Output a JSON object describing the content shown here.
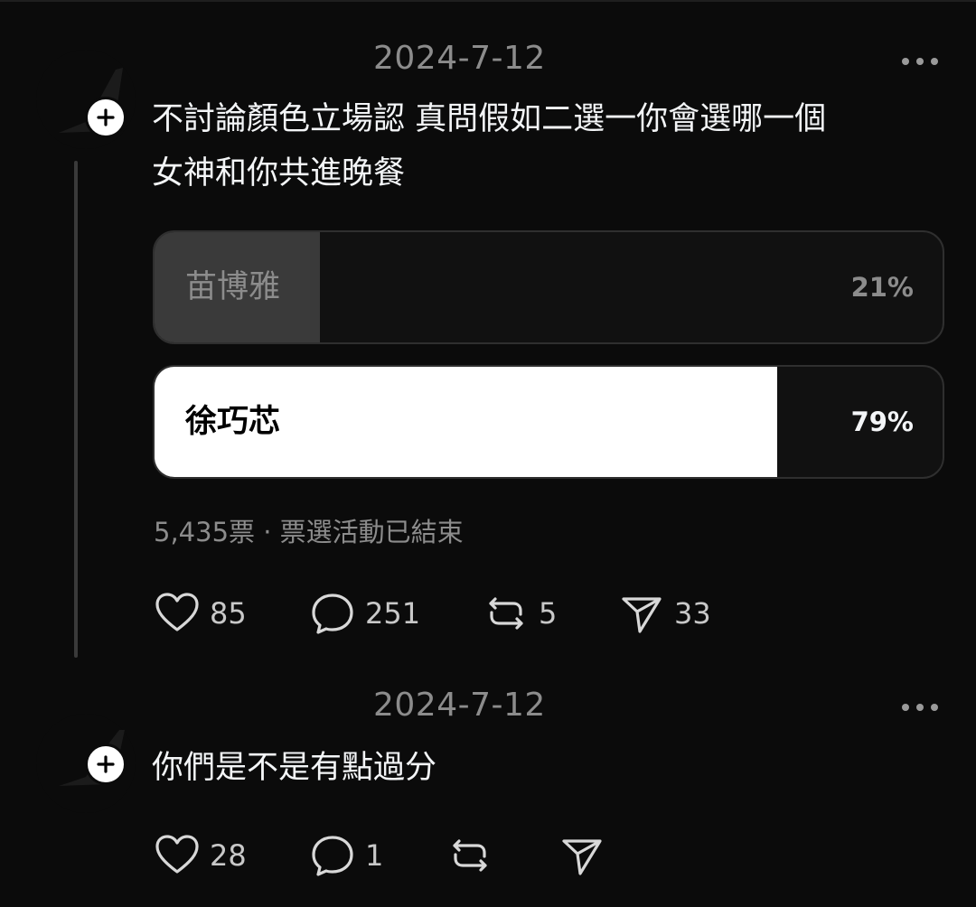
{
  "posts": [
    {
      "date": "2024-7-12",
      "text_line1": "不討論顏色立場認 真問假如二選一你會選哪一個",
      "text_line2": "女神和你共進晚餐",
      "poll": {
        "options": [
          {
            "label": "苗博雅",
            "percent_text": "21%",
            "percent": 21,
            "winner": false
          },
          {
            "label": "徐巧芯",
            "percent_text": "79%",
            "percent": 79,
            "winner": true
          }
        ],
        "summary": "5,435票 · 票選活動已結束"
      },
      "actions": {
        "likes": "85",
        "comments": "251",
        "reposts": "5",
        "shares": "33"
      }
    },
    {
      "date": "2024-7-12",
      "text_line1": "你們是不是有點過分",
      "actions": {
        "likes": "28",
        "comments": "1",
        "reposts": "",
        "shares": ""
      }
    }
  ],
  "icons": {
    "like": "heart-icon",
    "comment": "comment-bubble-icon",
    "repost": "repost-icon",
    "share": "send-icon",
    "more": "more-dots-icon",
    "follow": "plus-icon"
  },
  "colors": {
    "background": "#0b0b0b",
    "text": "#f3f5f7",
    "muted": "#8c8c8c",
    "poll_winner_fill": "#ffffff",
    "poll_loser_fill": "#3a3a3a"
  }
}
